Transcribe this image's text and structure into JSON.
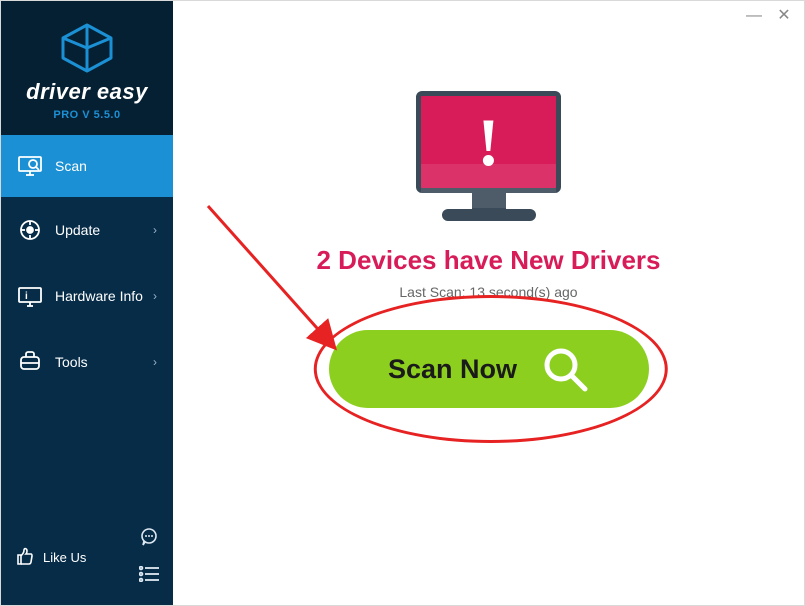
{
  "brand": {
    "name": "driver easy",
    "version": "PRO V 5.5.0"
  },
  "sidebar": {
    "items": [
      {
        "label": "Scan"
      },
      {
        "label": "Update"
      },
      {
        "label": "Hardware Info"
      },
      {
        "label": "Tools"
      }
    ],
    "like": "Like Us"
  },
  "main": {
    "headline": "2 Devices have New Drivers",
    "lastscan": "Last Scan: 13 second(s) ago",
    "scan_label": "Scan Now"
  }
}
